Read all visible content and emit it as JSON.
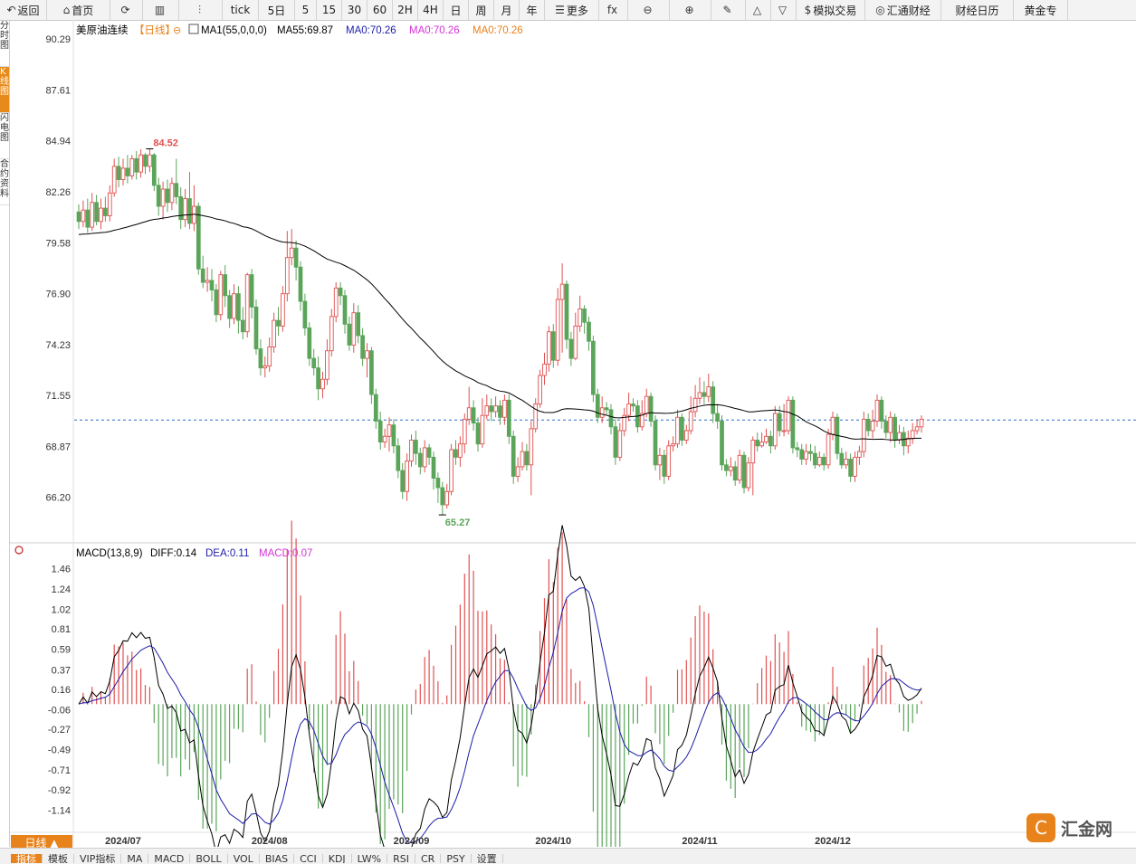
{
  "toolbar": [
    {
      "label": "返回",
      "icon": "back-arrow-icon",
      "glyph": "↶",
      "w": 52
    },
    {
      "label": "首页",
      "icon": "home-icon",
      "glyph": "⌂",
      "w": 70
    },
    {
      "label": "",
      "icon": "refresh-icon",
      "glyph": "⟳",
      "w": 36
    },
    {
      "label": "",
      "icon": "kline-chart-icon",
      "glyph": "▥",
      "w": 40
    },
    {
      "label": "",
      "icon": "candlestick-icon",
      "glyph": "⫶",
      "w": 48
    },
    {
      "label": "tick",
      "icon": "",
      "glyph": "",
      "w": 40
    },
    {
      "label": "5日",
      "icon": "",
      "glyph": "",
      "w": 40
    },
    {
      "label": "5",
      "icon": "",
      "glyph": "",
      "w": 24
    },
    {
      "label": "15",
      "icon": "",
      "glyph": "",
      "w": 28
    },
    {
      "label": "30",
      "icon": "",
      "glyph": "",
      "w": 28
    },
    {
      "label": "60",
      "icon": "",
      "glyph": "",
      "w": 28
    },
    {
      "label": "2H",
      "icon": "",
      "glyph": "",
      "w": 28
    },
    {
      "label": "4H",
      "icon": "",
      "glyph": "",
      "w": 28
    },
    {
      "label": "日",
      "icon": "",
      "glyph": "",
      "w": 28
    },
    {
      "label": "周",
      "icon": "",
      "glyph": "",
      "w": 28
    },
    {
      "label": "月",
      "icon": "",
      "glyph": "",
      "w": 28
    },
    {
      "label": "年",
      "icon": "",
      "glyph": "",
      "w": 28
    },
    {
      "label": "更多",
      "icon": "menu-icon",
      "glyph": "☰",
      "w": 60
    },
    {
      "label": "",
      "icon": "formula-fx-icon",
      "glyph": "fx",
      "w": 32
    },
    {
      "label": "",
      "icon": "zoom-out-icon",
      "glyph": "⊖",
      "w": 46
    },
    {
      "label": "",
      "icon": "zoom-in-icon",
      "glyph": "⊕",
      "w": 46
    },
    {
      "label": "",
      "icon": "draw-pen-icon",
      "glyph": "✎",
      "w": 38
    },
    {
      "label": "",
      "icon": "triangle-up-icon",
      "glyph": "△",
      "w": 28
    },
    {
      "label": "",
      "icon": "triangle-down-icon",
      "glyph": "▽",
      "w": 28
    },
    {
      "label": "模拟交易",
      "icon": "dollar-icon",
      "glyph": "$",
      "w": 76
    },
    {
      "label": "汇通财经",
      "icon": "huitong-logo-icon",
      "glyph": "◎",
      "w": 84
    },
    {
      "label": "财经日历",
      "icon": "",
      "glyph": "",
      "w": 80
    },
    {
      "label": "黄金专",
      "icon": "",
      "glyph": "",
      "w": 60
    }
  ],
  "side_tabs": [
    "分时图",
    "K线图",
    "闪电图",
    "合约资料"
  ],
  "legend_main": {
    "name": "美原油连续",
    "period": "【日线】",
    "ma_title": "MA1(55,0,0,0)",
    "ma55": "MA55:69.87",
    "ma0a": "MA0:70.26",
    "ma0b": "MA0:70.26",
    "ma0c": "MA0:70.26"
  },
  "legend_macd": {
    "title": "MACD(13,8,9)",
    "diff": "DIFF:0.14",
    "dea": "DEA:0.11",
    "macd": "MACD:0.07"
  },
  "high_label": "84.52",
  "low_label": "65.27",
  "period_button": "日线 ▲",
  "bottom_tabs": [
    "指标",
    "模板",
    "VIP指标",
    "MA",
    "MACD",
    "BOLL",
    "VOL",
    "BIAS",
    "CCI",
    "KDJ",
    "LW%",
    "RSI",
    "CR",
    "PSY",
    "设置"
  ],
  "watermark": "汇金网",
  "watermark_logo": "C",
  "colors": {
    "up": "#e15151",
    "down": "#5aa55a",
    "ma": "#000000",
    "dea": "#1c1ca8",
    "ref": "#2d6fc9"
  },
  "chart_data": {
    "type": "candlestick",
    "title": "美原油连续",
    "price_ticks": [
      90.29,
      87.61,
      84.94,
      82.26,
      79.58,
      76.9,
      74.23,
      71.55,
      68.87,
      66.2
    ],
    "macd_ticks": [
      1.46,
      1.24,
      1.02,
      0.81,
      0.59,
      0.37,
      0.16,
      -0.06,
      -0.27,
      -0.49,
      -0.71,
      -0.92,
      -1.14
    ],
    "price_range": [
      63.8,
      91.3
    ],
    "macd_range": [
      -1.36,
      1.56
    ],
    "reference_price": 70.26,
    "x_labels": [
      {
        "label": "2024/07",
        "i": 10
      },
      {
        "label": "2024/08",
        "i": 43
      },
      {
        "label": "2024/09",
        "i": 75
      },
      {
        "label": "2024/10",
        "i": 107
      },
      {
        "label": "2024/11",
        "i": 140
      },
      {
        "label": "2024/12",
        "i": 170
      }
    ],
    "high": {
      "value": 84.52,
      "i": 16
    },
    "low": {
      "value": 65.27,
      "i": 82
    },
    "candles": [
      [
        81.2,
        80.7,
        81.6,
        80.3
      ],
      [
        80.7,
        81.3,
        81.8,
        80.4
      ],
      [
        81.3,
        80.4,
        81.9,
        80.1
      ],
      [
        80.4,
        81.7,
        82.2,
        80.2
      ],
      [
        81.7,
        80.7,
        82.1,
        80.5
      ],
      [
        80.7,
        81.4,
        81.9,
        80.3
      ],
      [
        81.4,
        81.0,
        82.0,
        80.7
      ],
      [
        81.0,
        82.2,
        82.6,
        80.7
      ],
      [
        82.2,
        83.6,
        84.0,
        82.0
      ],
      [
        83.6,
        82.9,
        84.1,
        82.5
      ],
      [
        82.9,
        83.5,
        84.0,
        82.6
      ],
      [
        83.5,
        83.1,
        84.2,
        82.7
      ],
      [
        83.1,
        84.0,
        84.2,
        82.9
      ],
      [
        84.0,
        83.3,
        84.4,
        82.9
      ],
      [
        83.3,
        84.2,
        84.5,
        83.0
      ],
      [
        84.2,
        83.6,
        84.3,
        83.2
      ],
      [
        83.6,
        84.2,
        84.52,
        83.3
      ],
      [
        84.2,
        82.6,
        84.3,
        82.3
      ],
      [
        82.6,
        81.5,
        83.0,
        81.0
      ],
      [
        81.5,
        82.4,
        82.8,
        80.8
      ],
      [
        82.4,
        81.7,
        82.9,
        81.2
      ],
      [
        81.7,
        82.7,
        83.0,
        81.3
      ],
      [
        82.7,
        82.0,
        84.0,
        81.6
      ],
      [
        82.0,
        80.8,
        82.5,
        80.3
      ],
      [
        80.8,
        81.9,
        82.4,
        80.4
      ],
      [
        81.9,
        80.6,
        83.3,
        80.3
      ],
      [
        80.6,
        81.5,
        82.6,
        80.2
      ],
      [
        81.5,
        78.2,
        81.7,
        77.9
      ],
      [
        78.2,
        77.5,
        78.9,
        77.2
      ],
      [
        77.5,
        77.6,
        78.3,
        77.0
      ],
      [
        77.6,
        77.1,
        78.2,
        76.5
      ],
      [
        77.1,
        75.8,
        77.4,
        75.4
      ],
      [
        75.8,
        77.9,
        78.1,
        75.5
      ],
      [
        77.9,
        76.8,
        78.4,
        76.2
      ],
      [
        76.8,
        75.6,
        77.1,
        75.1
      ],
      [
        75.6,
        76.9,
        77.4,
        75.3
      ],
      [
        76.9,
        75.5,
        77.3,
        74.8
      ],
      [
        75.5,
        74.9,
        76.2,
        74.5
      ],
      [
        74.9,
        77.9,
        78.0,
        74.6
      ],
      [
        77.9,
        76.2,
        78.2,
        75.6
      ],
      [
        76.2,
        74.0,
        76.6,
        73.7
      ],
      [
        74.0,
        73.0,
        74.5,
        72.6
      ],
      [
        73.0,
        73.1,
        73.6,
        72.5
      ],
      [
        73.1,
        74.1,
        74.6,
        72.8
      ],
      [
        74.1,
        75.5,
        75.9,
        73.8
      ],
      [
        75.5,
        75.2,
        76.2,
        74.7
      ],
      [
        75.2,
        76.9,
        77.3,
        74.9
      ],
      [
        76.9,
        78.8,
        80.2,
        76.5
      ],
      [
        78.8,
        79.3,
        80.3,
        78.4
      ],
      [
        79.3,
        78.3,
        79.7,
        77.6
      ],
      [
        78.3,
        76.5,
        78.6,
        76.0
      ],
      [
        76.5,
        75.1,
        76.9,
        74.7
      ],
      [
        75.1,
        73.5,
        75.4,
        73.1
      ],
      [
        73.5,
        73.0,
        74.0,
        72.6
      ],
      [
        73.0,
        71.9,
        73.6,
        71.3
      ],
      [
        71.9,
        72.4,
        72.8,
        71.4
      ],
      [
        72.4,
        73.9,
        74.5,
        72.1
      ],
      [
        73.9,
        75.7,
        76.1,
        73.6
      ],
      [
        75.7,
        77.2,
        77.5,
        75.4
      ],
      [
        77.2,
        76.8,
        77.5,
        76.3
      ],
      [
        76.8,
        75.3,
        77.1,
        74.8
      ],
      [
        75.3,
        74.2,
        75.7,
        73.9
      ],
      [
        74.2,
        75.9,
        76.4,
        73.8
      ],
      [
        75.9,
        74.7,
        76.3,
        74.3
      ],
      [
        74.7,
        73.5,
        75.1,
        73.1
      ],
      [
        73.5,
        73.9,
        74.3,
        72.5
      ],
      [
        73.9,
        71.6,
        74.1,
        71.1
      ],
      [
        71.6,
        70.2,
        71.9,
        69.8
      ],
      [
        70.2,
        69.1,
        70.7,
        68.7
      ],
      [
        69.1,
        69.4,
        69.8,
        68.8
      ],
      [
        69.4,
        70.0,
        70.4,
        68.6
      ],
      [
        70.0,
        68.9,
        70.3,
        68.5
      ],
      [
        68.9,
        67.6,
        69.3,
        67.2
      ],
      [
        67.6,
        66.5,
        68.0,
        66.1
      ],
      [
        66.5,
        68.1,
        68.5,
        66.0
      ],
      [
        68.1,
        69.2,
        69.5,
        67.8
      ],
      [
        69.2,
        68.5,
        69.7,
        67.9
      ],
      [
        68.5,
        67.8,
        68.8,
        67.4
      ],
      [
        67.8,
        68.8,
        69.2,
        67.5
      ],
      [
        68.8,
        68.3,
        69.0,
        67.9
      ],
      [
        68.3,
        67.2,
        68.6,
        66.6
      ],
      [
        67.2,
        66.7,
        67.5,
        65.9
      ],
      [
        66.7,
        65.8,
        67.0,
        65.27
      ],
      [
        65.8,
        66.5,
        66.9,
        65.6
      ],
      [
        66.5,
        68.7,
        69.0,
        66.3
      ],
      [
        68.7,
        68.3,
        69.2,
        67.9
      ],
      [
        68.3,
        69.0,
        69.4,
        67.8
      ],
      [
        69.0,
        70.3,
        70.6,
        68.5
      ],
      [
        70.3,
        70.9,
        72.0,
        70.0
      ],
      [
        70.9,
        70.1,
        71.3,
        69.7
      ],
      [
        70.1,
        69.0,
        70.4,
        68.6
      ],
      [
        69.0,
        70.5,
        71.4,
        68.8
      ],
      [
        70.5,
        71.0,
        71.6,
        70.3
      ],
      [
        71.0,
        70.7,
        71.4,
        70.2
      ],
      [
        70.7,
        71.0,
        71.5,
        70.4
      ],
      [
        71.0,
        70.4,
        71.3,
        70.0
      ],
      [
        70.4,
        71.3,
        71.6,
        70.0
      ],
      [
        71.3,
        69.4,
        71.6,
        69.0
      ],
      [
        69.4,
        67.3,
        69.7,
        66.9
      ],
      [
        67.3,
        67.8,
        68.3,
        67.0
      ],
      [
        67.8,
        68.6,
        69.1,
        67.6
      ],
      [
        68.6,
        67.9,
        69.0,
        67.6
      ],
      [
        67.9,
        69.8,
        70.2,
        66.3
      ],
      [
        69.8,
        71.1,
        71.4,
        69.6
      ],
      [
        71.1,
        72.6,
        72.9,
        70.9
      ],
      [
        72.6,
        73.2,
        73.8,
        72.1
      ],
      [
        73.2,
        74.9,
        75.2,
        72.8
      ],
      [
        74.9,
        73.4,
        75.3,
        73.0
      ],
      [
        73.4,
        76.6,
        77.2,
        73.1
      ],
      [
        76.6,
        77.4,
        78.5,
        73.8
      ],
      [
        77.4,
        74.5,
        77.6,
        74.0
      ],
      [
        74.5,
        73.5,
        74.9,
        73.1
      ],
      [
        73.5,
        75.2,
        75.9,
        73.4
      ],
      [
        75.2,
        76.1,
        76.8,
        74.9
      ],
      [
        76.1,
        75.4,
        76.3,
        74.8
      ],
      [
        75.4,
        74.4,
        75.7,
        73.9
      ],
      [
        74.4,
        71.6,
        74.7,
        71.2
      ],
      [
        71.6,
        70.4,
        71.9,
        70.1
      ],
      [
        70.4,
        70.9,
        71.5,
        70.1
      ],
      [
        70.9,
        70.8,
        71.2,
        70.5
      ],
      [
        70.8,
        69.9,
        71.1,
        69.5
      ],
      [
        69.9,
        68.3,
        70.3,
        67.9
      ],
      [
        68.3,
        69.7,
        70.1,
        68.1
      ],
      [
        69.7,
        70.5,
        70.9,
        69.4
      ],
      [
        70.5,
        71.1,
        71.7,
        70.2
      ],
      [
        71.1,
        71.0,
        71.4,
        70.7
      ],
      [
        71.0,
        69.9,
        71.3,
        69.6
      ],
      [
        69.9,
        70.6,
        71.3,
        69.7
      ],
      [
        70.6,
        71.5,
        71.9,
        70.4
      ],
      [
        71.5,
        70.2,
        71.7,
        69.9
      ],
      [
        70.2,
        67.9,
        70.5,
        67.6
      ],
      [
        67.9,
        68.4,
        68.8,
        67.1
      ],
      [
        68.4,
        67.3,
        68.7,
        66.9
      ],
      [
        67.3,
        68.9,
        69.2,
        67.1
      ],
      [
        68.9,
        69.0,
        69.4,
        68.6
      ],
      [
        69.0,
        70.4,
        70.8,
        68.8
      ],
      [
        70.4,
        69.2,
        70.6,
        68.9
      ],
      [
        69.2,
        69.7,
        70.0,
        69.0
      ],
      [
        69.7,
        70.7,
        71.5,
        69.5
      ],
      [
        70.7,
        71.4,
        72.1,
        70.4
      ],
      [
        71.4,
        71.7,
        72.5,
        71.1
      ],
      [
        71.7,
        71.5,
        72.3,
        71.1
      ],
      [
        71.5,
        72.0,
        72.7,
        71.2
      ],
      [
        72.0,
        70.6,
        72.3,
        70.1
      ],
      [
        70.6,
        70.2,
        71.1,
        69.8
      ],
      [
        70.2,
        67.9,
        70.5,
        67.6
      ],
      [
        67.9,
        67.6,
        68.2,
        67.3
      ],
      [
        67.6,
        67.8,
        68.3,
        67.3
      ],
      [
        67.8,
        67.1,
        68.1,
        66.8
      ],
      [
        67.1,
        68.4,
        68.7,
        66.9
      ],
      [
        68.4,
        66.7,
        68.6,
        66.4
      ],
      [
        66.7,
        68.0,
        68.3,
        66.5
      ],
      [
        68.0,
        69.2,
        69.4,
        66.3
      ],
      [
        69.2,
        68.9,
        69.6,
        68.6
      ],
      [
        68.9,
        69.1,
        69.6,
        68.8
      ],
      [
        69.1,
        69.4,
        69.8,
        69.0
      ],
      [
        69.4,
        68.9,
        69.7,
        68.5
      ],
      [
        68.9,
        70.6,
        71.0,
        68.7
      ],
      [
        70.6,
        69.7,
        71.0,
        69.4
      ],
      [
        69.7,
        69.7,
        71.1,
        69.4
      ],
      [
        69.7,
        71.3,
        71.5,
        69.5
      ],
      [
        71.3,
        68.8,
        71.5,
        68.5
      ],
      [
        68.8,
        68.7,
        69.1,
        68.3
      ],
      [
        68.7,
        68.2,
        69.0,
        67.9
      ],
      [
        68.2,
        68.6,
        69.0,
        67.9
      ],
      [
        68.6,
        68.5,
        69.0,
        68.1
      ],
      [
        68.5,
        67.9,
        68.9,
        67.7
      ],
      [
        67.9,
        68.3,
        68.6,
        67.8
      ],
      [
        68.3,
        67.9,
        68.5,
        67.6
      ],
      [
        67.9,
        69.5,
        69.8,
        67.7
      ],
      [
        69.5,
        70.4,
        70.7,
        69.2
      ],
      [
        70.4,
        68.5,
        70.6,
        68.2
      ],
      [
        68.5,
        67.9,
        68.8,
        67.7
      ],
      [
        67.9,
        68.2,
        68.6,
        67.7
      ],
      [
        68.2,
        67.3,
        68.5,
        67.0
      ],
      [
        67.3,
        68.3,
        68.6,
        67.0
      ],
      [
        68.3,
        68.6,
        68.9,
        67.9
      ],
      [
        68.6,
        70.3,
        70.7,
        68.3
      ],
      [
        70.3,
        69.7,
        70.6,
        69.4
      ],
      [
        69.7,
        70.2,
        70.8,
        69.3
      ],
      [
        70.2,
        71.3,
        71.6,
        69.9
      ],
      [
        71.3,
        70.2,
        71.5,
        69.8
      ],
      [
        70.2,
        69.6,
        70.5,
        69.3
      ],
      [
        69.6,
        70.4,
        70.7,
        69.1
      ],
      [
        70.4,
        69.2,
        70.6,
        68.8
      ],
      [
        69.2,
        69.6,
        70.0,
        69.0
      ],
      [
        69.6,
        68.9,
        69.9,
        68.4
      ],
      [
        68.9,
        69.3,
        69.7,
        68.5
      ],
      [
        69.3,
        69.7,
        70.1,
        69.0
      ],
      [
        69.7,
        69.9,
        70.3,
        69.5
      ],
      [
        69.9,
        70.3,
        70.5,
        69.6
      ]
    ]
  }
}
